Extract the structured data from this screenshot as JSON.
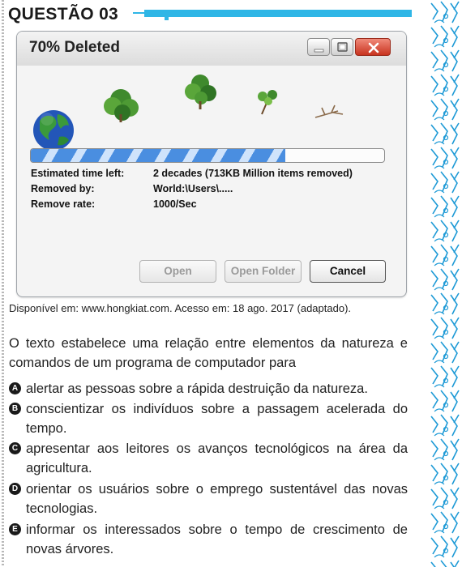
{
  "question": {
    "number_label": "QUESTÃO 03"
  },
  "window": {
    "title": "70% Deleted",
    "progress_fraction": 0.72,
    "fields": [
      {
        "label": "Estimated time left:",
        "value": "2 decades (713KB Million items removed)"
      },
      {
        "label": "Removed by:",
        "value": "World:\\Users\\....."
      },
      {
        "label": "Remove rate:",
        "value": "1000/Sec"
      }
    ],
    "buttons": {
      "open": "Open",
      "open_folder": "Open Folder",
      "cancel": "Cancel"
    },
    "icons": [
      "earth-icon",
      "tree-icon",
      "tree-icon",
      "small-tree-icon",
      "dead-branch-icon"
    ]
  },
  "source_text": "Disponível em: www.hongkiat.com. Acesso em: 18 ago. 2017 (adaptado).",
  "statement": "O texto estabelece uma relação entre elementos da natureza e comandos de um programa de computador para",
  "options": [
    {
      "letter": "A",
      "text": "alertar as pessoas sobre a rápida destruição da natureza."
    },
    {
      "letter": "B",
      "text": "conscientizar os indivíduos sobre a passagem acelerada do tempo."
    },
    {
      "letter": "C",
      "text": "apresentar aos leitores os avanços tecnológicos na área da agricultura."
    },
    {
      "letter": "D",
      "text": "orientar os usuários sobre o emprego sustentável das novas tecnologias."
    },
    {
      "letter": "E",
      "text": "informar os interessados sobre o tempo de crescimento de novas árvores."
    }
  ],
  "colors": {
    "accent_bar": "#2fb6e6",
    "progress_blue": "#4a8ee0",
    "close_red": "#c8331f",
    "decor_blue": "#1e9ad6"
  }
}
